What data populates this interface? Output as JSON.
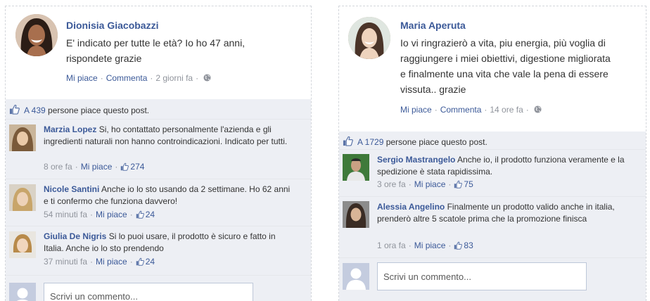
{
  "posts": [
    {
      "author": "Dionisia Giacobazzi",
      "text": "E' indicato per tutte le età? Io ho 47 anni, rispondete grazie",
      "like_label": "Mi piace",
      "comment_label": "Commenta",
      "time": "2 giorni fa",
      "likes_prefix": "A 439",
      "likes_suffix": " persone piace questo post.",
      "comments": [
        {
          "name": "Marzia Lopez",
          "text": "Si, ho contattato personalmente l'azienda e gli ingredienti naturali non hanno controindicazioni. Indicato per tutti.",
          "time": "8 ore fa",
          "like_label": "Mi piace",
          "likes": "274"
        },
        {
          "name": "Nicole Santini",
          "text": "Anche io lo sto usando da 2 settimane. Ho 62 anni e ti confermo che funziona davvero!",
          "time": "54 minuti fa",
          "like_label": "Mi piace",
          "likes": "24"
        },
        {
          "name": "Giulia De Nigris",
          "text": "Si lo puoi usare, il prodotto è sicuro e fatto in Italia. Anche io lo sto prendendo",
          "time": "37 minuti fa",
          "like_label": "Mi piace",
          "likes": "24"
        }
      ],
      "reply_placeholder": "Scrivi un commento..."
    },
    {
      "author": "Maria Aperuta",
      "text": "Io vi ringrazierò a vita, piu energia, più voglia di raggiungere i miei obiettivi, digestione migliorata e finalmente una vita che vale la pena di essere vissuta.. grazie",
      "like_label": "Mi piace",
      "comment_label": "Commenta",
      "time": "14 ore fa",
      "likes_prefix": "A 1729",
      "likes_suffix": " persone piace questo post.",
      "comments": [
        {
          "name": "Sergio Mastrangelo",
          "text": "Anche io, il prodotto funziona veramente e la spedizione è stata rapidissima.",
          "time": "3 ore fa",
          "like_label": "Mi piace",
          "likes": "75"
        },
        {
          "name": "Alessia Angelino",
          "text": "Finalmente un prodotto valido anche in italia, prenderò altre 5 scatole prima che la promozione finisca",
          "time": "1 ora fa",
          "like_label": "Mi piace",
          "likes": "83"
        }
      ],
      "reply_placeholder": "Scrivi un commento..."
    }
  ],
  "icons": {
    "thumb": "thumbs-up-icon",
    "globe": "globe-icon",
    "avatar_placeholder": "default-avatar-icon"
  },
  "colors": {
    "link": "#3b5998",
    "meta": "#90949c",
    "panel": "#edeff4",
    "border": "#d3d6db"
  }
}
